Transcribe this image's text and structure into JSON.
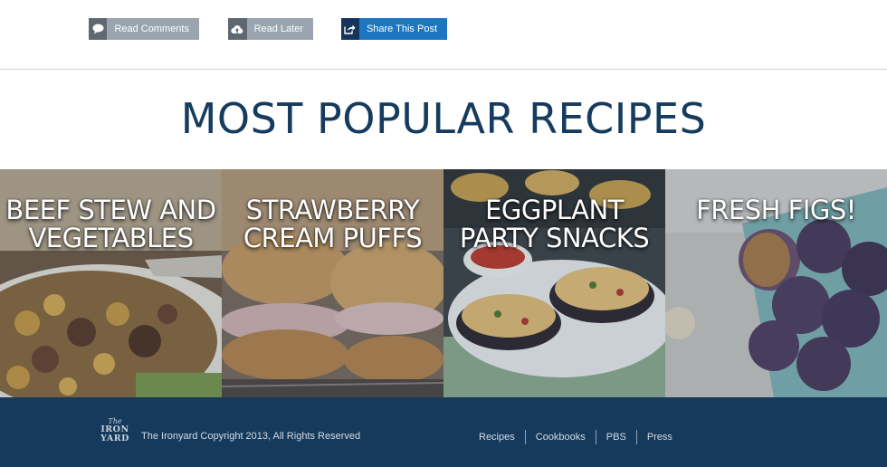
{
  "actions": {
    "read_comments": "Read Comments",
    "read_later": "Read Later",
    "share": "Share This Post"
  },
  "section_title": "MOST POPULAR RECIPES",
  "recipes": [
    {
      "title": "BEEF STEW AND VEGETABLES"
    },
    {
      "title": "STRAWBERRY CREAM PUFFS"
    },
    {
      "title": "EGGPLANT PARTY SNACKS"
    },
    {
      "title": "FRESH FIGS!"
    }
  ],
  "footer": {
    "logo": {
      "the": "The",
      "line1": "IRON",
      "line2": "YARD"
    },
    "copyright": "The Ironyard Copyright 2013, All Rights Reserved",
    "nav": [
      "Recipes",
      "Cookbooks",
      "PBS",
      "Press"
    ]
  },
  "colors": {
    "heading": "#153b5f",
    "footer_bg": "#163a5c",
    "share_blue": "#1c76c2",
    "button_grey": "#9aa5b0"
  },
  "icons": {
    "read_comments": "speech-bubble-icon",
    "read_later": "cloud-upload-icon",
    "share": "share-arrow-icon"
  }
}
